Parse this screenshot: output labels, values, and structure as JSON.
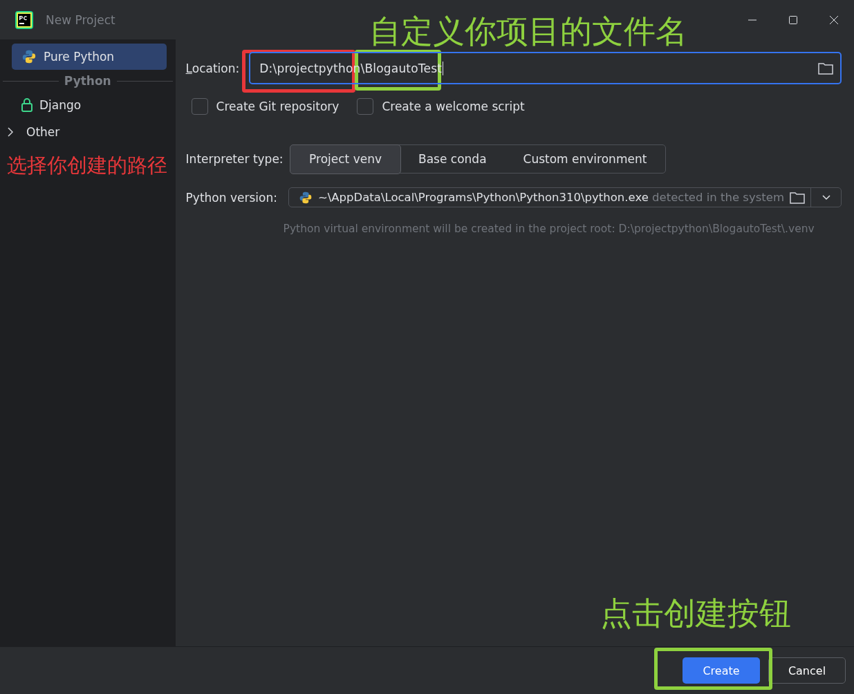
{
  "window": {
    "title": "New Project"
  },
  "sidebar": {
    "items": [
      {
        "kind": "python",
        "label": "Pure Python",
        "selected": true
      },
      {
        "kind": "section",
        "label": "Python"
      },
      {
        "kind": "django",
        "label": "Django",
        "selected": false
      },
      {
        "kind": "group",
        "label": "Other",
        "expanded": false
      }
    ]
  },
  "location": {
    "label": "Location:",
    "value": "D:\\projectpython\\BlogautoTest"
  },
  "checkboxes": [
    {
      "label": "Create Git repository",
      "checked": false
    },
    {
      "label": "Create a welcome script",
      "checked": false
    }
  ],
  "interpreter_type": {
    "label": "Interpreter type:",
    "options": [
      {
        "label": "Project venv",
        "selected": true
      },
      {
        "label": "Base conda",
        "selected": false
      },
      {
        "label": "Custom environment",
        "selected": false
      }
    ]
  },
  "python_version": {
    "label": "Python version:",
    "path": "~\\AppData\\Local\\Programs\\Python\\Python310\\python.exe",
    "hint": "detected in the system"
  },
  "note": "Python virtual environment will be created in the project root: D:\\projectpython\\BlogautoTest\\.venv",
  "buttons": [
    {
      "label": "Create",
      "kind": "primary"
    },
    {
      "label": "Cancel",
      "kind": "secondary"
    }
  ],
  "annotations": [
    {
      "kind": "label",
      "text": "自定义你项目的文件名",
      "color": "#8ed13f"
    },
    {
      "kind": "box",
      "color": "#e8373a"
    },
    {
      "kind": "box",
      "color": "#8ed13f"
    },
    {
      "kind": "label",
      "text": "选择你创建的路径",
      "color": "#e8373a"
    },
    {
      "kind": "label",
      "text": "点击创建按钮",
      "color": "#8ed13f"
    },
    {
      "kind": "box",
      "color": "#8ed13f"
    }
  ]
}
